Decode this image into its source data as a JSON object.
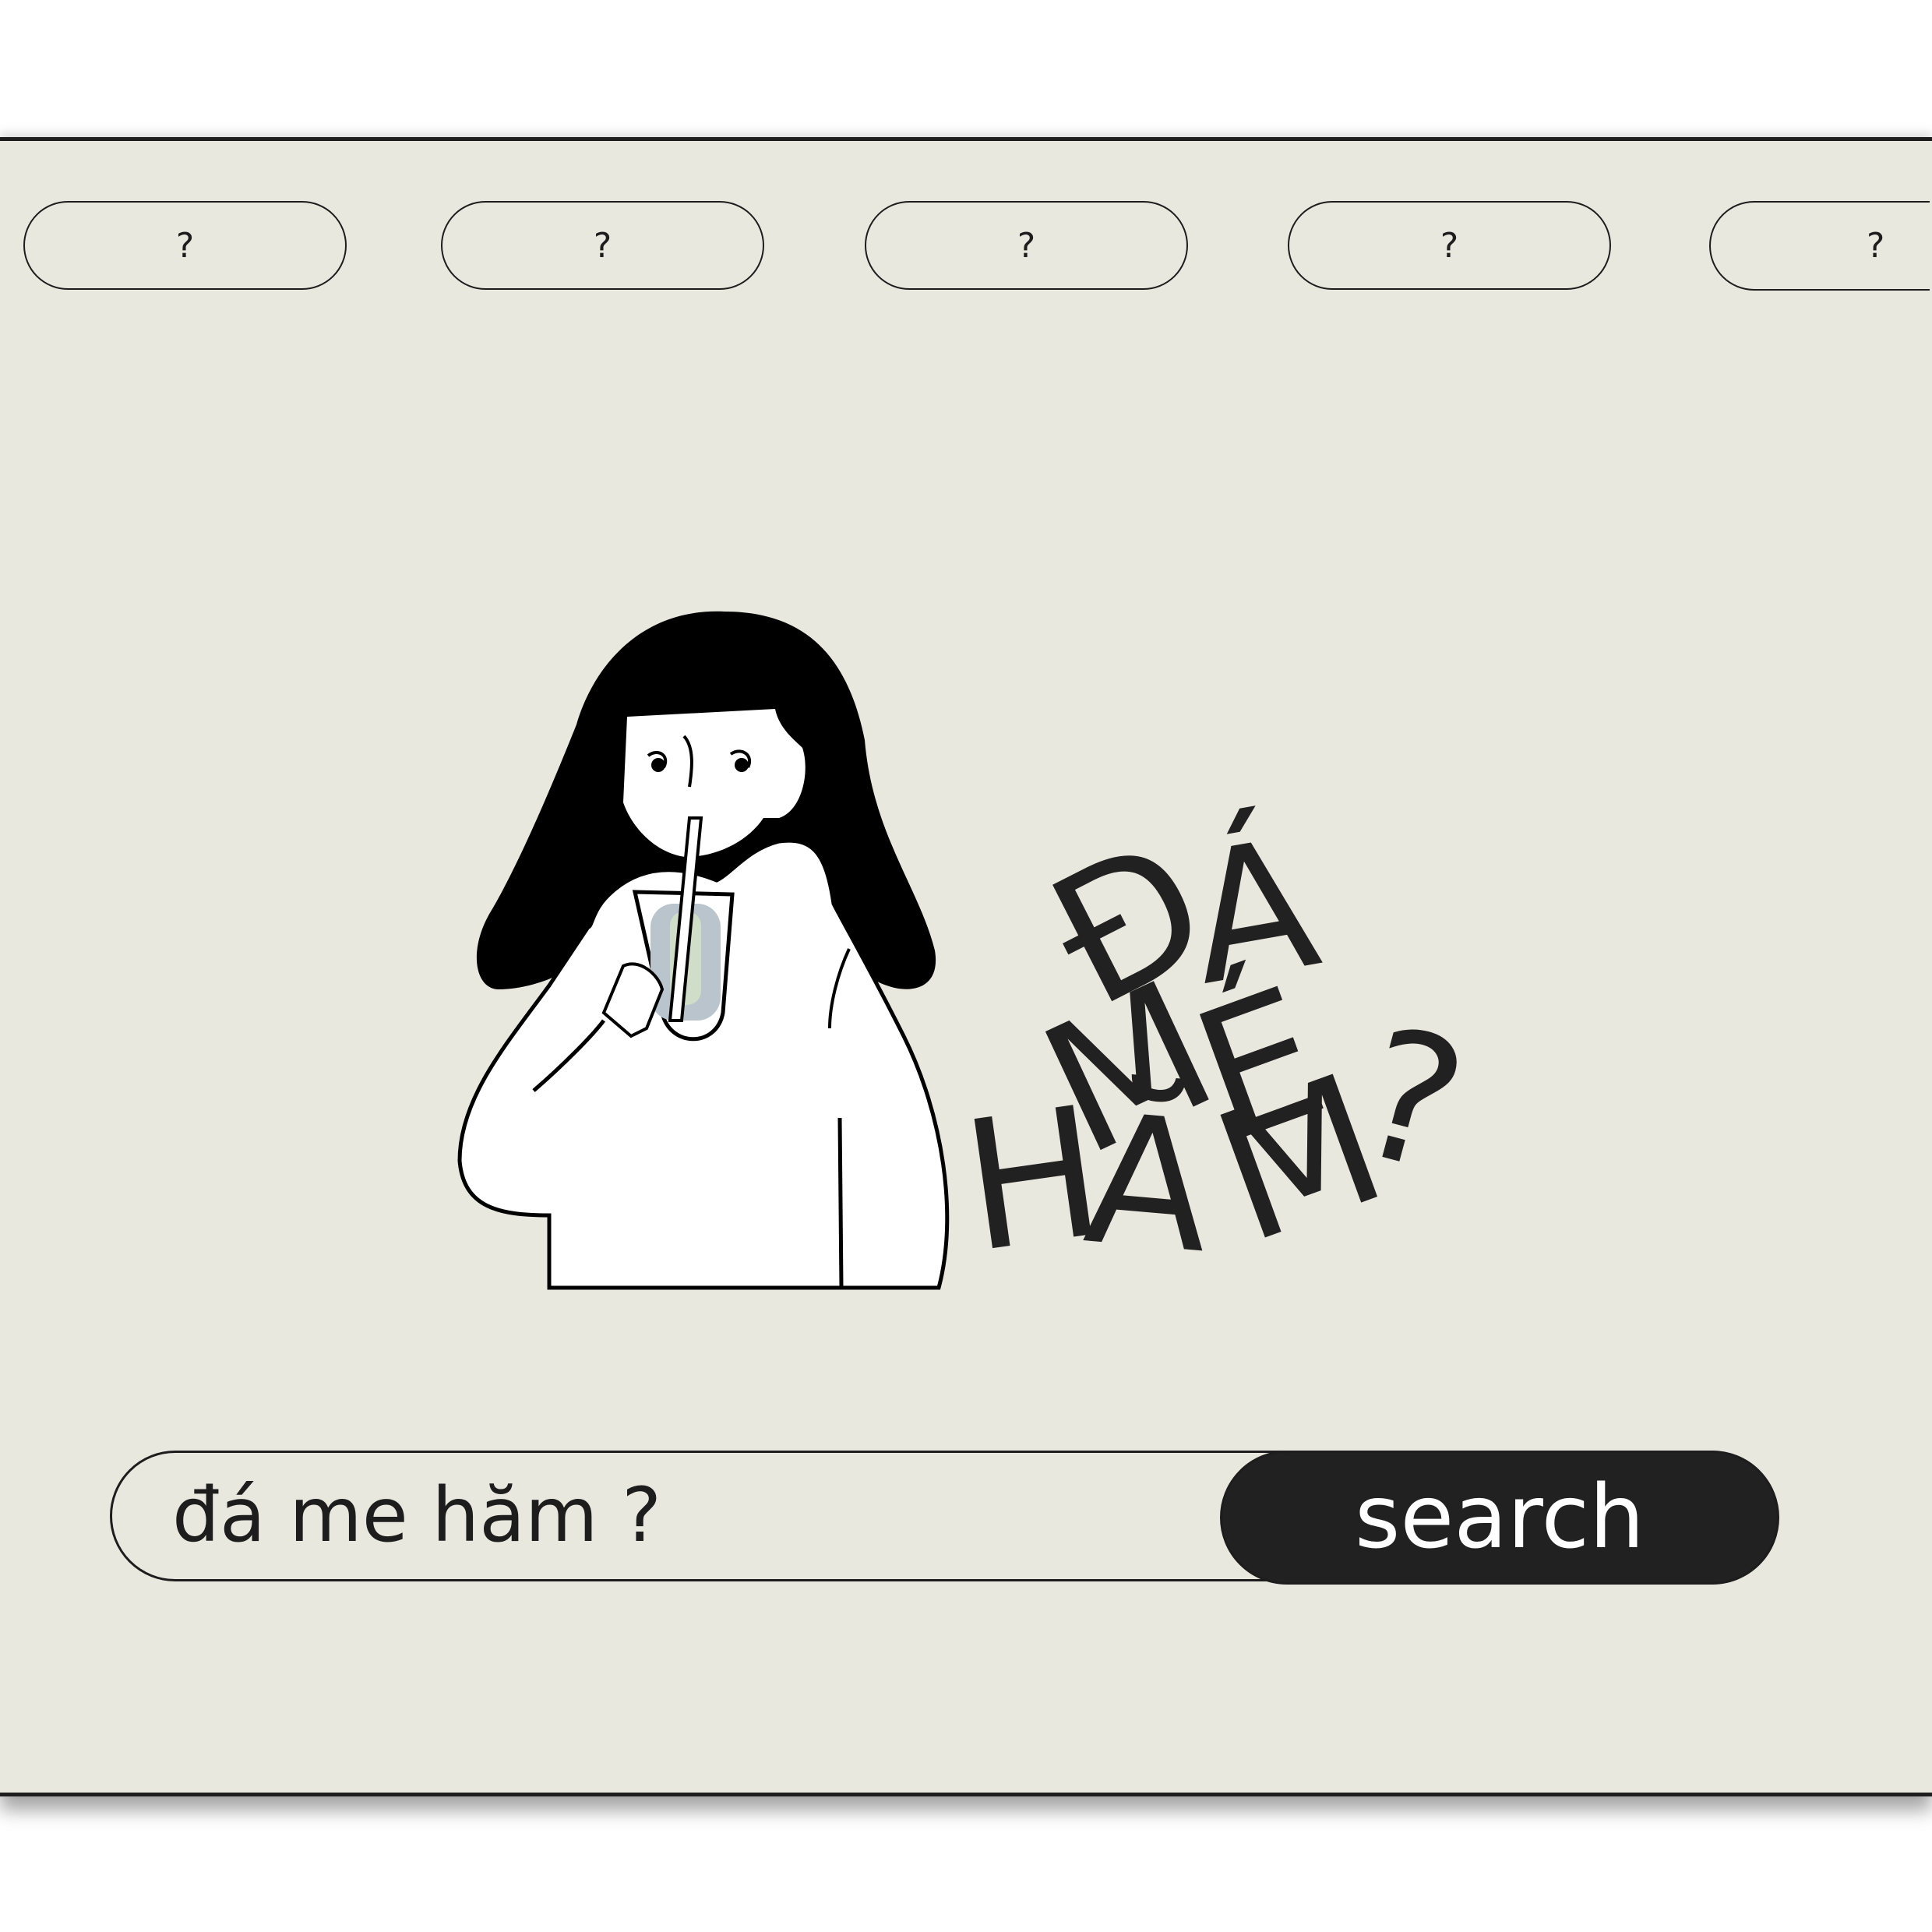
{
  "nav": {
    "pills": [
      {
        "label": "?"
      },
      {
        "label": "?"
      },
      {
        "label": "?"
      },
      {
        "label": "?"
      },
      {
        "label": "?"
      }
    ]
  },
  "headline": {
    "letters": [
      "Đ",
      "Á",
      "M",
      "É",
      "H",
      "Ă",
      "M",
      "?"
    ]
  },
  "search": {
    "value": "đá me hăm ?",
    "button_label": "search"
  },
  "colors": {
    "background": "#e9e8df",
    "ink": "#222121",
    "button_text": "#ffffff"
  }
}
